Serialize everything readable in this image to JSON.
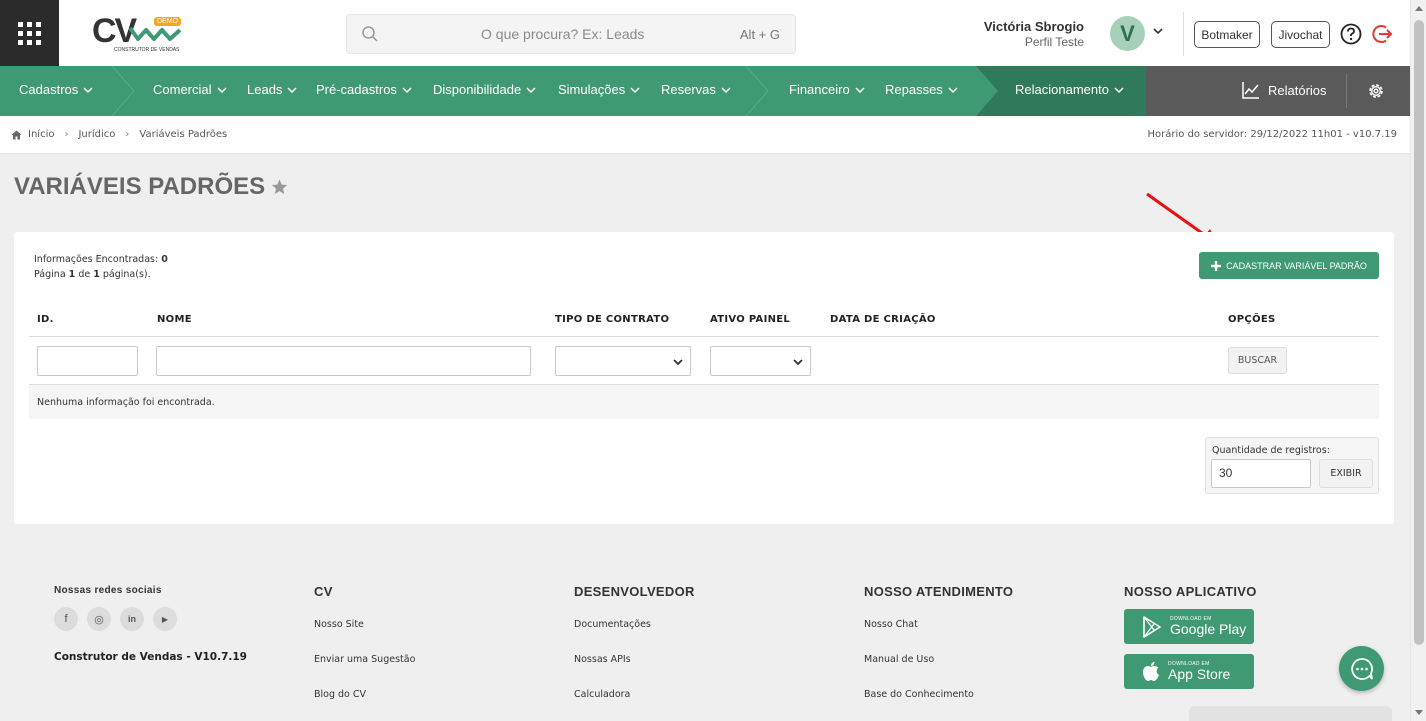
{
  "header": {
    "logo_text": "CV",
    "logo_badge": "DEMO",
    "logo_subtitle": "CONSTRUTOR DE VENDAS",
    "search_placeholder": "O que procura? Ex: Leads",
    "search_shortcut": "Alt + G",
    "user_name": "Victória Sbrogio",
    "user_profile": "Perfil Teste",
    "avatar_letter": "V",
    "botmaker_label": "Botmaker",
    "jivochat_label": "Jivochat"
  },
  "nav": {
    "items": [
      "Cadastros",
      "Comercial",
      "Leads",
      "Pré-cadastros",
      "Disponibilidade",
      "Simulações",
      "Reservas",
      "Financeiro",
      "Repasses",
      "Relacionamento"
    ],
    "reports_label": "Relatórios"
  },
  "breadcrumb": {
    "items": [
      "Início",
      "Jurídico",
      "Variáveis Padrões"
    ],
    "server_time": "Horário do servidor: 29/12/2022 11h01 - v10.7.19"
  },
  "page": {
    "title": "VARIÁVEIS PADRÕES",
    "info_found_label": "Informações Encontradas:",
    "info_found_count": "0",
    "page_word": "Página",
    "page_current": "1",
    "page_of": "de",
    "page_total": "1",
    "page_suffix": "página(s).",
    "add_button": "CADASTRAR VARIÁVEL PADRÃO",
    "columns": [
      "ID.",
      "NOME",
      "TIPO DE CONTRATO",
      "ATIVO PAINEL",
      "DATA DE CRIAÇÃO",
      "OPÇÕES"
    ],
    "search_button": "BUSCAR",
    "empty_message": "Nenhuma informação foi encontrada.",
    "qty_label": "Quantidade de registros:",
    "qty_value": "30",
    "show_button": "EXIBIR"
  },
  "footer": {
    "social_title": "Nossas redes sociais",
    "social_icons": [
      "f",
      "◎",
      "in",
      "▶"
    ],
    "version": "Construtor de Vendas - V10.7.19",
    "col_cv": {
      "title": "CV",
      "links": [
        "Nosso Site",
        "Enviar uma Sugestão",
        "Blog do CV"
      ]
    },
    "col_dev": {
      "title": "DESENVOLVEDOR",
      "links": [
        "Documentações",
        "Nossas APIs",
        "Calculadora"
      ]
    },
    "col_support": {
      "title": "NOSSO ATENDIMENTO",
      "links": [
        "Nosso Chat",
        "Manual de Uso",
        "Base do Conhecimento"
      ]
    },
    "col_app": {
      "title": "NOSSO APLICATIVO",
      "google_small": "DOWNLOAD EM",
      "google_label": "Google Play",
      "apple_small": "DOWNLOAD EM",
      "apple_label": "App Store"
    }
  },
  "colors": {
    "brand_green": "#3f9a74",
    "nav_dark_green": "#2f7a5a",
    "nav_gray": "#5a5a5a",
    "logout_red": "#e53935",
    "annotation_arrow": "#e81010"
  }
}
